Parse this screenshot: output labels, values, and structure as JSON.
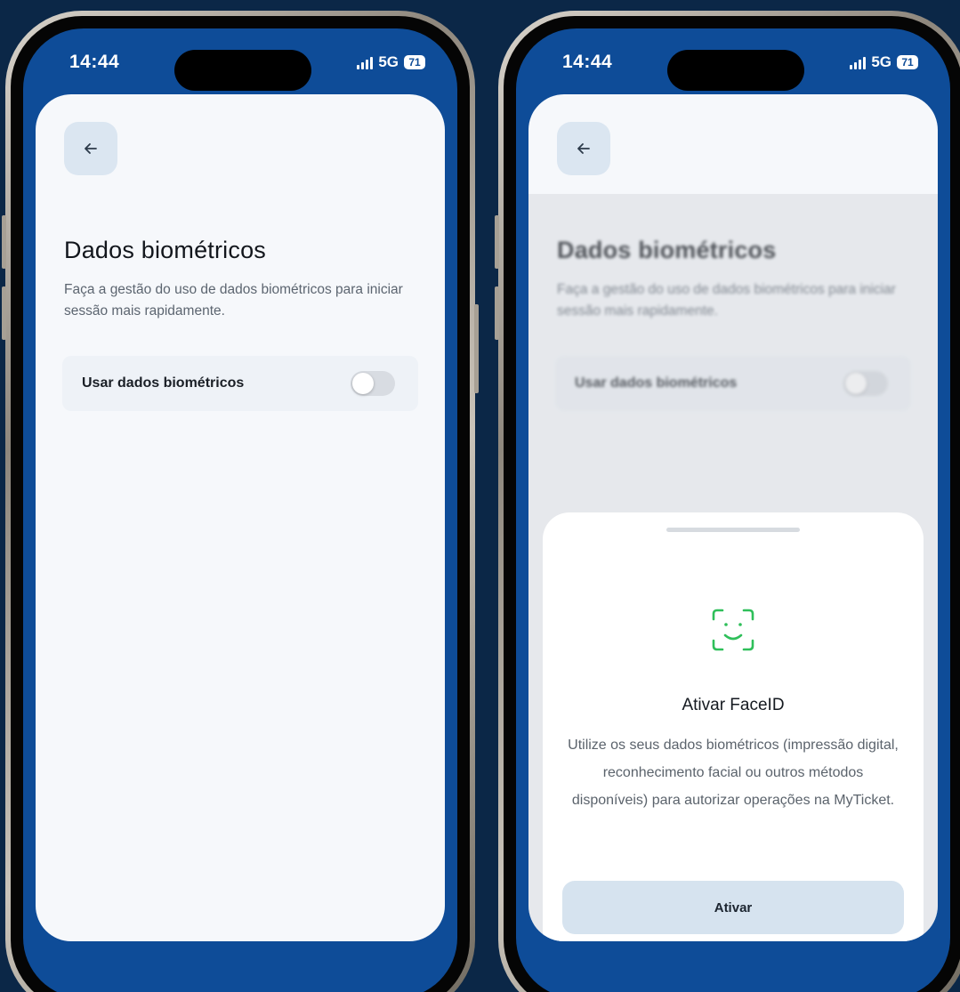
{
  "status_bar": {
    "time": "14:44",
    "network": "5G",
    "battery": "71"
  },
  "settings_screen": {
    "title": "Dados biométricos",
    "subtitle": "Faça a gestão do uso de dados biométricos para iniciar sessão mais rapidamente.",
    "toggle_label": "Usar dados biométricos",
    "toggle_on": false
  },
  "faceid_sheet": {
    "icon": "faceid-icon",
    "title": "Ativar FaceID",
    "body": "Utilize os seus dados biométricos (impressão digital, reconhecimento facial ou outros métodos disponíveis) para autorizar operações na MyTicket.",
    "button_label": "Ativar"
  },
  "colors": {
    "background": "#0b2747",
    "screen_blue": "#0e4c98",
    "card": "#f6f8fb",
    "faceid_green": "#2fbf5a",
    "button": "#d6e3ef"
  }
}
